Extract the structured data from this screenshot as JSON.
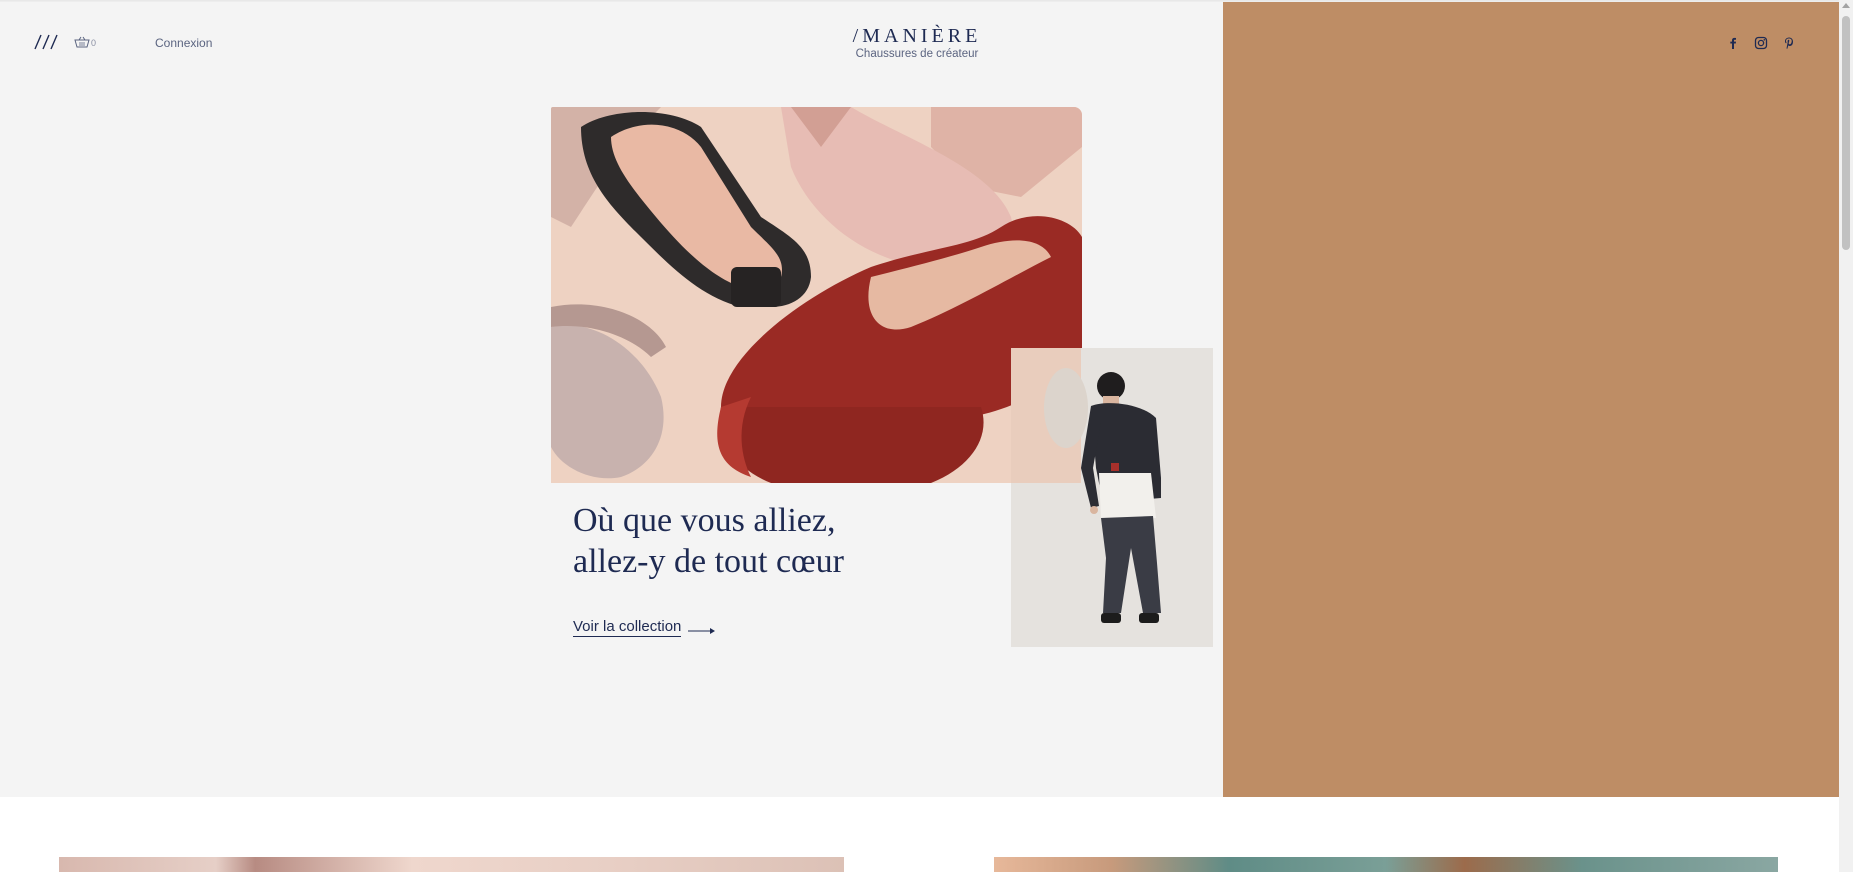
{
  "header": {
    "cart_count": "0",
    "login_label": "Connexion",
    "logo_name": "/MANIÈRE",
    "logo_tagline": "Chaussures de créateur",
    "social_icons": [
      "facebook-icon",
      "instagram-icon",
      "pinterest-icon"
    ]
  },
  "hero": {
    "headline_line1": "Où que vous alliez,",
    "headline_line2": "allez-y de tout cœur",
    "cta_label": "Voir la collection"
  },
  "colors": {
    "brand_navy": "#1e2a52",
    "hero_background": "#f4f4f4",
    "accent_panel": "#be8d65"
  }
}
